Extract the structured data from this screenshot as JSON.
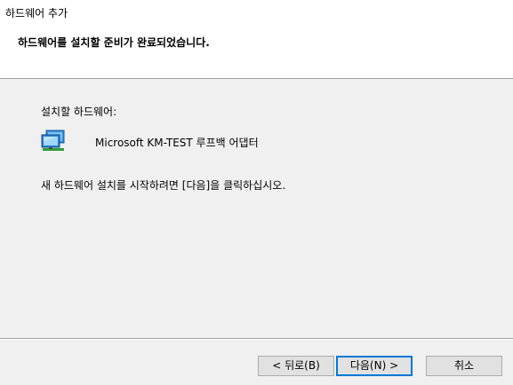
{
  "window": {
    "title": "하드웨어 추가"
  },
  "header": {
    "heading": "하드웨어를 설치할 준비가 완료되었습니다."
  },
  "content": {
    "section_label": "설치할 하드웨어:",
    "device": {
      "name": "Microsoft KM-TEST 루프백 어댑터",
      "icon": "network-adapter-icon"
    },
    "instruction": "새 하드웨어 설치를 시작하려면 [다음]을 클릭하십시오."
  },
  "buttons": {
    "back_label": "< 뒤로(B)",
    "next_label": "다음(N) >",
    "cancel_label": "취소"
  },
  "colors": {
    "primary_focus": "#0078d7",
    "header_bg": "#ffffff",
    "body_bg": "#f0f0f0"
  }
}
